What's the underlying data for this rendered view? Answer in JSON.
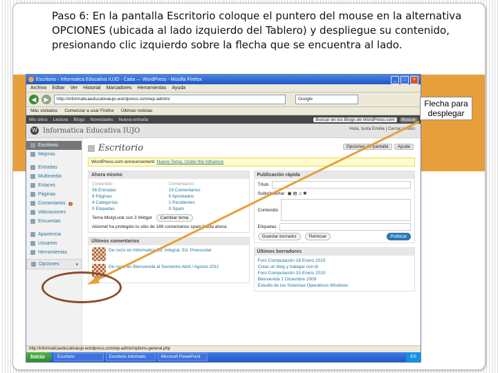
{
  "instruction": "Paso 6: En la pantalla Escritorio coloque el puntero del mouse en la alternativa OPCIONES  (ubicada al lado izquierdo del Tablero) y despliegue su contenido, presionando clic izquierdo sobre la flecha que se encuentra al lado.",
  "callout": "Flecha para desplegar",
  "browser": {
    "title": "Escritorio ‹ Informatica Educativa IUJO - Catia — WordPress - Mozilla Firefox",
    "menu": [
      "Archivo",
      "Editar",
      "Ver",
      "Historial",
      "Marcadores",
      "Herramientas",
      "Ayuda"
    ],
    "url": "http://informaticaeducativaiujo.wordpress.com/wp-admin/",
    "search_placeholder": "Google",
    "bookmarks": [
      "Más visitados",
      "Comenzar a usar Firefox",
      "Últimas noticias"
    ]
  },
  "wp": {
    "adminbar_left": [
      "Mis sitios",
      "Lectura",
      "Blogs",
      "Novedades",
      "Nueva entrada"
    ],
    "adminbar_search": "Buscar en los Blogs de WordPress.com",
    "adminbar_btn": "Buscar",
    "site_name": "Informatica Educativa IUJO",
    "howdy": "Hola, Iusta Emilia  |  Cerrar sesión",
    "page_title": "Escritorio",
    "screen_options": "Opciones de pantalla",
    "help": "Ayuda",
    "notice": "WordPress.com announcement:",
    "notice_link": "Nuevo Tema: Under the Influence",
    "sidebar": [
      {
        "label": "Escritorio",
        "active": true
      },
      {
        "label": "Mejoras"
      },
      {
        "label": "Entradas"
      },
      {
        "label": "Multimedia"
      },
      {
        "label": "Enlaces"
      },
      {
        "label": "Páginas"
      },
      {
        "label": "Comentarios",
        "badge": "1"
      },
      {
        "label": "Valoraciones"
      },
      {
        "label": "Encuestas"
      },
      {
        "label": "Apariencia"
      },
      {
        "label": "Usuarios"
      },
      {
        "label": "Herramientas"
      },
      {
        "label": "Opciones"
      }
    ],
    "ahora": {
      "title": "Ahora mismo",
      "col1_head": "Contenido",
      "col2_head": "Comentarios",
      "col1": [
        "56  Entradas",
        "6  Páginas",
        "4  Categorías",
        "0  Etiquetas"
      ],
      "col2": [
        "19  Comentarios",
        "0  Aprobados",
        "1  Pendientes",
        "0  Spam"
      ],
      "theme_line": "Tema MistyLook con 3 Widget",
      "theme_btn": "Cambiar tema",
      "akismet": "Akismet ha protegido tu sitio de 146 comentarios spam hasta ahora."
    },
    "rapida": {
      "title": "Publicación rápida",
      "label_title": "Título",
      "label_upload": "Subir/Insertar",
      "label_content": "Contenido",
      "label_tags": "Etiquetas",
      "btn_draft": "Guardar borrador",
      "btn_reset": "Reiniciar",
      "btn_publish": "Publicar"
    },
    "comments": {
      "title": "Últimos comentarios",
      "items": [
        "De rocío en Informatica Ed. Integral, Ed. Preescolar",
        "De rocío en Bienvenida al Semestre Abril / Agosto 2011"
      ]
    },
    "drafts": {
      "title": "Últimos borradores",
      "items": [
        "Foro Computación 18 Enero 2010",
        "Crear un blog y trabajar con él",
        "Foro Computación 15 Enero 2010",
        "Bienvenida 1 Diciembre 2009",
        "Estudio de los Sistemas Operativos Windows"
      ]
    },
    "status": "http://informaticaeducativaiujo.wordpress.com/wp-admin/options-general.php"
  },
  "taskbar": {
    "start": "Inicio",
    "tasks": [
      "Escritorio",
      "Escritorio Informatic",
      "Microsoft PowerPoint"
    ],
    "tray": "ES"
  }
}
